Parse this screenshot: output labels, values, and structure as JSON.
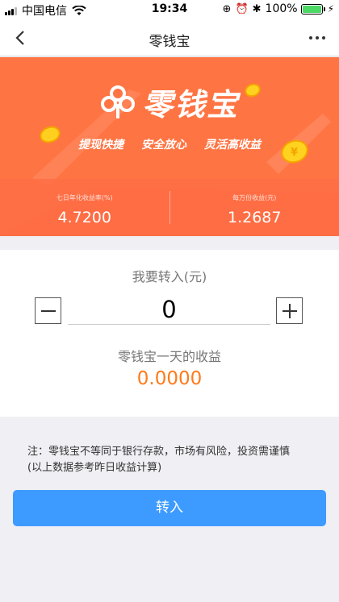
{
  "status_bar": {
    "carrier": "中国电信",
    "time": "19:34",
    "battery": "100%",
    "battery_level": 1.0
  },
  "nav": {
    "title": "零钱宝"
  },
  "banner": {
    "logo_text": "零钱宝",
    "slogans": [
      "提现快捷",
      "安全放心",
      "灵活高收益"
    ],
    "stats": [
      {
        "label": "七日年化收益率(%)",
        "value": "4.7200"
      },
      {
        "label": "每万份收益(元)",
        "value": "1.2687"
      }
    ]
  },
  "transfer": {
    "title": "我要转入(元)",
    "amount": "0",
    "earn_label": "零钱宝一天的收益",
    "earn_value": "0.0000"
  },
  "notice": {
    "line1": "注：零钱宝不等同于银行存款，市场有风险，投资需谨慎",
    "line2": "(以上数据参考昨日收益计算)"
  },
  "submit_label": "转入",
  "colors": {
    "banner": "#ff7443",
    "accent": "#ff7a1a",
    "button": "#3d9bff"
  }
}
